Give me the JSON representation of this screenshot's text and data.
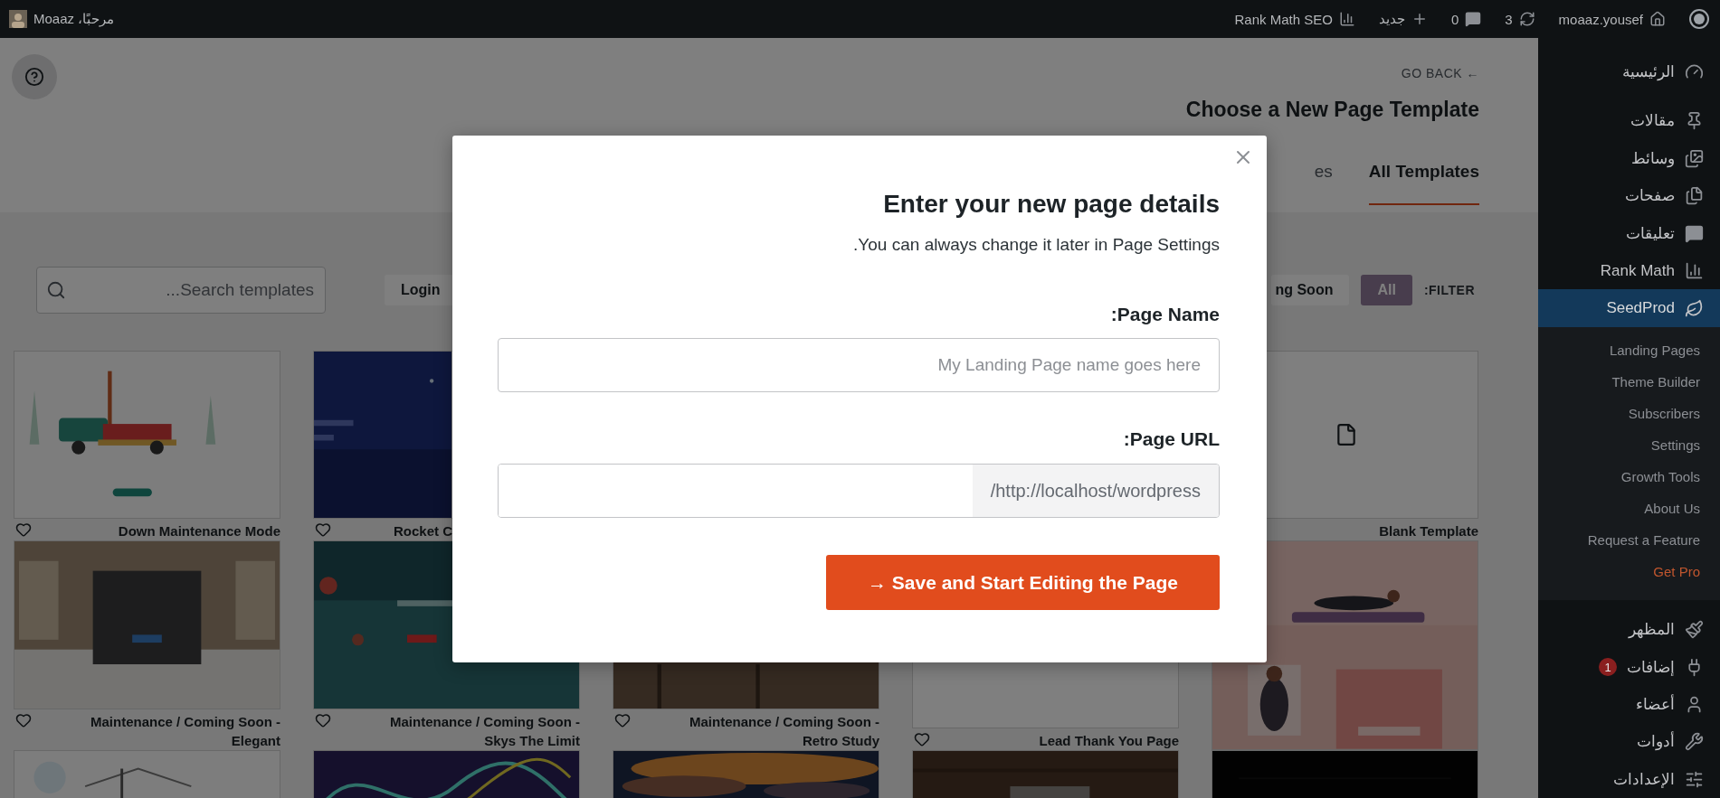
{
  "admin_bar": {
    "greeting": "مرحبًا، Moaaz",
    "items": [
      {
        "kind": "seo",
        "label": "Rank Math SEO"
      },
      {
        "kind": "new",
        "label": "جديد"
      },
      {
        "kind": "comments",
        "label": "0"
      },
      {
        "kind": "updates",
        "label": "3"
      },
      {
        "kind": "account",
        "label": "moaaz.yousef"
      }
    ]
  },
  "header": {
    "back_link": "GO BACK ←",
    "title": "Choose a New Page Template",
    "tabs": [
      {
        "label": "es",
        "selected": false
      },
      {
        "label": "All Templates",
        "selected": true
      }
    ]
  },
  "toolbar": {
    "search": {
      "placeholder": "...Search templates"
    },
    "filters": [
      {
        "label": "Login",
        "selected": false
      },
      {
        "label": "ng Soon",
        "selected": false
      },
      {
        "label": "All",
        "selected": true
      }
    ],
    "filter_label": ":FILTER"
  },
  "templates": [
    {
      "title": "Down Maintenance Mode",
      "kind": "picture"
    },
    {
      "title": "Rocket C",
      "kind": "picture"
    },
    {
      "title": "Blank Template",
      "kind": "blank"
    },
    {
      "title": "Maintenance / Coming Soon - Elegant",
      "kind": "picture"
    },
    {
      "title": "Maintenance / Coming Soon - Skys The Limit",
      "kind": "picture"
    },
    {
      "title": "Maintenance / Coming Soon - Retro Study",
      "kind": "picture"
    },
    {
      "title": "Lead Thank You Page",
      "kind": "plain"
    },
    {
      "kind": "picture"
    },
    {
      "kind": "picture"
    },
    {
      "kind": "picture"
    },
    {
      "kind": "picture"
    },
    {
      "kind": "picture"
    },
    {
      "kind": "picture"
    }
  ],
  "modal": {
    "title": "Enter your new page details",
    "subtitle": ".You can always change it later in Page Settings",
    "fields": [
      {
        "label": ":Page Name",
        "placeholder": "My Landing Page name goes here"
      },
      {
        "label": ":Page URL",
        "prefix": "/http://localhost/wordpress"
      }
    ],
    "submit": "→ Save and Start Editing the Page"
  },
  "sidebar": {
    "items": [
      {
        "label": "الرئيسية",
        "kind": "dashboard",
        "selected": false
      },
      {
        "label": "مقالات",
        "kind": "posts",
        "selected": false
      },
      {
        "label": "وسائط",
        "kind": "media",
        "selected": false
      },
      {
        "label": "صفحات",
        "kind": "pages",
        "selected": false
      },
      {
        "label": "تعليقات",
        "kind": "comments",
        "selected": false
      },
      {
        "label": "Rank Math",
        "kind": "rankmath",
        "selected": false
      },
      {
        "label": "SeedProd",
        "kind": "seedprod",
        "selected": true,
        "submenu": [
          {
            "label": "Landing Pages",
            "kind": "link"
          },
          {
            "label": "Theme Builder",
            "kind": "link"
          },
          {
            "label": "Subscribers",
            "kind": "link"
          },
          {
            "label": "Settings",
            "kind": "link"
          },
          {
            "label": "Growth Tools",
            "kind": "link"
          },
          {
            "label": "About Us",
            "kind": "link"
          },
          {
            "label": "Request a Feature",
            "kind": "link"
          },
          {
            "label": "Get Pro",
            "kind": "upgrade"
          }
        ]
      },
      {
        "label": "المظهر",
        "kind": "appearance",
        "selected": false
      },
      {
        "label": "إضافات",
        "kind": "plugins",
        "selected": false,
        "badge": "1"
      },
      {
        "label": "أعضاء",
        "kind": "users",
        "selected": false
      },
      {
        "label": "أدوات",
        "kind": "tools",
        "selected": false
      },
      {
        "label": "الإعدادات",
        "kind": "settings",
        "selected": false
      }
    ]
  }
}
